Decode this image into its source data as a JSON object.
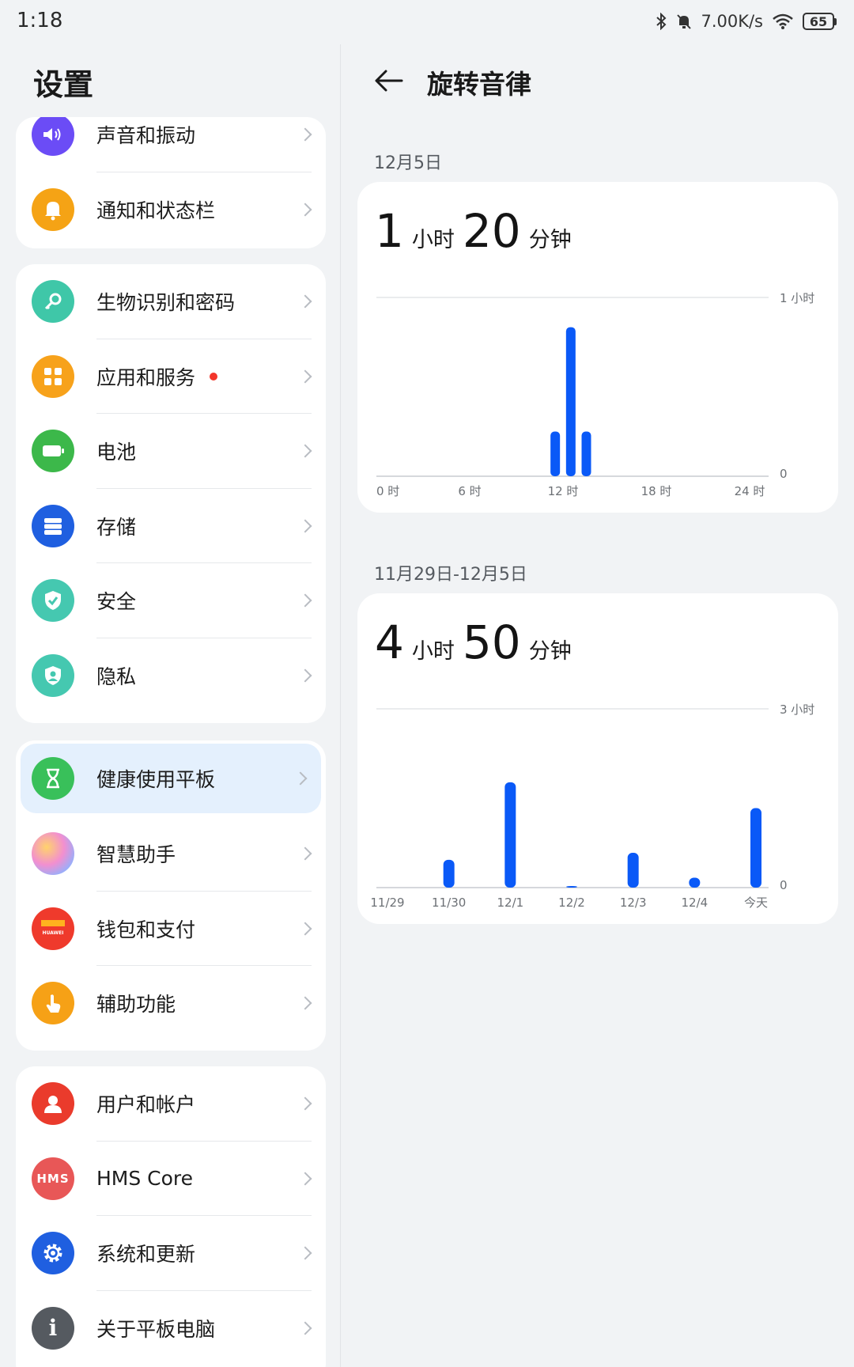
{
  "status": {
    "time": "1:18",
    "network_speed": "7.00K/s",
    "battery": "65",
    "icons": [
      "bluetooth-icon",
      "mute-icon",
      "wifi-icon",
      "battery-icon"
    ]
  },
  "settings": {
    "title": "设置",
    "groups": [
      {
        "items": [
          {
            "label": "声音和振动",
            "icon": "sound-icon",
            "color": "#6b4cf6"
          },
          {
            "label": "通知和状态栏",
            "icon": "bell-icon",
            "color": "#f5a315"
          }
        ]
      },
      {
        "items": [
          {
            "label": "生物识别和密码",
            "icon": "key-icon",
            "color": "#3fc7a8"
          },
          {
            "label": "应用和服务",
            "icon": "apps-icon",
            "color": "#f7a21b",
            "badge": "red-dot"
          },
          {
            "label": "电池",
            "icon": "battery-icon",
            "color": "#3cb84a"
          },
          {
            "label": "存储",
            "icon": "storage-icon",
            "color": "#1f5fe0"
          },
          {
            "label": "安全",
            "icon": "shield-check-icon",
            "color": "#45c8b0"
          },
          {
            "label": "隐私",
            "icon": "privacy-shield-icon",
            "color": "#45c8b0"
          }
        ]
      },
      {
        "items": [
          {
            "label": "健康使用平板",
            "icon": "hourglass-icon",
            "color": "#39c05a",
            "selected": true
          },
          {
            "label": "智慧助手",
            "icon": "assistant-icon",
            "color": "#e79cd4"
          },
          {
            "label": "钱包和支付",
            "icon": "wallet-icon",
            "color": "#ef3a2c",
            "icon_text": "HUAWEI"
          },
          {
            "label": "辅助功能",
            "icon": "hand-icon",
            "color": "#f6a116"
          }
        ]
      },
      {
        "items": [
          {
            "label": "用户和帐户",
            "icon": "user-icon",
            "color": "#ea3b2c"
          },
          {
            "label": "HMS Core",
            "icon": "hms-icon",
            "color": "#e85757",
            "icon_text": "HMS"
          },
          {
            "label": "系统和更新",
            "icon": "gear-icon",
            "color": "#1f5fe0"
          },
          {
            "label": "关于平板电脑",
            "icon": "info-icon",
            "color": "#555a60",
            "icon_text": "i"
          }
        ]
      }
    ]
  },
  "detail": {
    "title": "旋转音律",
    "daily": {
      "date_label": "12月5日",
      "hours": "1",
      "hours_unit": "小时",
      "minutes": "20",
      "minutes_unit": "分钟"
    },
    "weekly": {
      "date_label": "11月29日-12月5日",
      "hours": "4",
      "hours_unit": "小时",
      "minutes": "50",
      "minutes_unit": "分钟"
    }
  },
  "chart_data": [
    {
      "type": "bar",
      "x_unit": "hour",
      "x_ticks": [
        "0 时",
        "6 时",
        "12 时",
        "18 时",
        "24 时"
      ],
      "y_ticks": [
        "0",
        "1 小时"
      ],
      "ylim": [
        0,
        60
      ],
      "y_unit": "minutes",
      "series": [
        {
          "values": [
            {
              "hour": 11.5,
              "value": 15
            },
            {
              "hour": 12.5,
              "value": 50
            },
            {
              "hour": 13.5,
              "value": 15
            }
          ]
        }
      ],
      "color": "#0a59f7",
      "grid": true
    },
    {
      "type": "bar",
      "categories": [
        "11/29",
        "11/30",
        "12/1",
        "12/2",
        "12/3",
        "12/4",
        "今天"
      ],
      "y_ticks": [
        "0",
        "3 小时"
      ],
      "ylim": [
        0,
        180
      ],
      "y_unit": "minutes",
      "series": [
        {
          "values": [
            0,
            28,
            106,
            1,
            35,
            10,
            80
          ]
        }
      ],
      "color": "#0a59f7",
      "grid": true
    }
  ]
}
